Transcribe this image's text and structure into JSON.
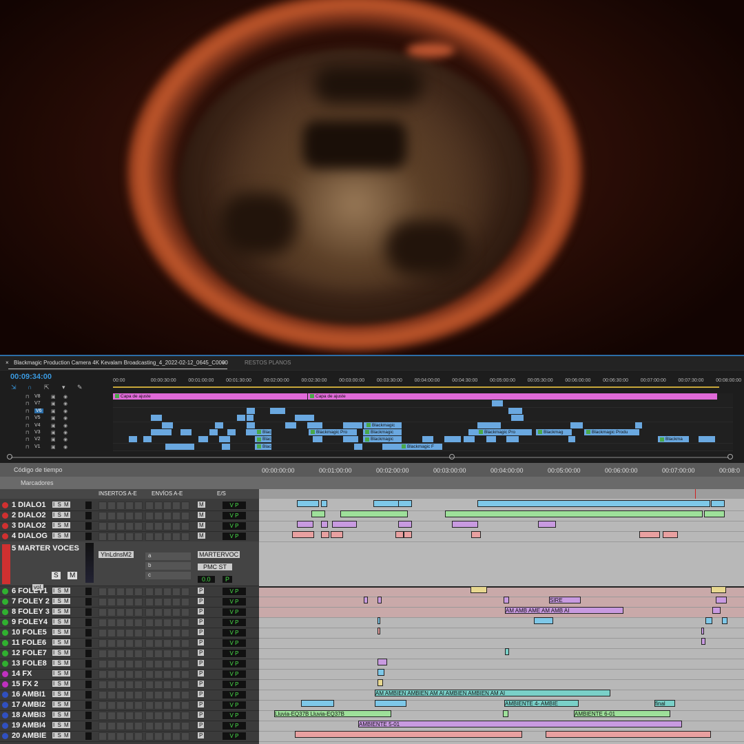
{
  "premiere": {
    "sequence_tab": "Blackmagic Production Camera 4K Kevalam Broadcasting_4_2022-02-12_0645_C0000",
    "second_tab": "RESTOS PLANOS",
    "timecode": "00:09:34:00",
    "ruler": [
      "00:00",
      "00:00:30:00",
      "00:01:00:00",
      "00:01:30:00",
      "00:02:00:00",
      "00:02:30:00",
      "00:03:00:00",
      "00:03:30:00",
      "00:04:00:00",
      "00:04:30:00",
      "00:05:00:00",
      "00:05:30:00",
      "00:06:00:00",
      "00:06:30:00",
      "00:07:00:00",
      "00:07:30:00",
      "00:08:00:00"
    ],
    "tracks": [
      "V8",
      "V7",
      "V6",
      "V5",
      "V4",
      "V3",
      "V2",
      "V1"
    ],
    "selected_track": "V6",
    "adjustment_clip": "Capa de ajuste",
    "clip_blackmagic": "Blackmagic",
    "clip_blackmagic_pro": "Blackmagic Pro",
    "clip_blackmagic_produ": "Blackmagic Produ",
    "clip_black": "Black",
    "clip_blackmag": "Blackmag",
    "clip_blackma": "Blackma",
    "clip_blackmagic_f": "Blackmagic F"
  },
  "protools": {
    "timecode_label": "Código de tiempo",
    "markers_label": "Marcadores",
    "ruler": [
      "00:00:00:00",
      "00:01:00:00",
      "00:02:00:00",
      "00:03:00:00",
      "00:04:00:00",
      "00:05:00:00",
      "00:06:00:00",
      "00:07:00:00",
      "00:08:0"
    ],
    "col_inserts": "INSERTOS A-E",
    "col_sends": "ENVÍOS A-E",
    "col_io": "E/S",
    "ism": "I S M",
    "io_m": "M",
    "io_p": "P",
    "vp": "V P",
    "master": {
      "name": "5 MARTER VOCES",
      "insert": "YlnLdnsM2",
      "out": "MARTERVOC",
      "pan": "PMC ST",
      "vol_label": "vol.",
      "value": "0.0",
      "s": "S",
      "m": "M",
      "send_a": "a",
      "send_b": "b",
      "send_c": "c",
      "p": "P"
    },
    "tracks": [
      {
        "name": "1 DIALO1",
        "color": "#d03030"
      },
      {
        "name": "2 DIALO2",
        "color": "#d03030"
      },
      {
        "name": "3 DIALO2",
        "color": "#d03030"
      },
      {
        "name": "4 DIALOG",
        "color": "#d03030"
      },
      {
        "name": "6 FOLEY1",
        "color": "#30b030"
      },
      {
        "name": "7 FOLEY 2",
        "color": "#30b030"
      },
      {
        "name": "8 FOLEY 3",
        "color": "#30b030"
      },
      {
        "name": "9 FOLEY4",
        "color": "#30b030"
      },
      {
        "name": "10 FOLE5",
        "color": "#30b030"
      },
      {
        "name": "11 FOLE6",
        "color": "#30b030"
      },
      {
        "name": "12 FOLE7",
        "color": "#30b030"
      },
      {
        "name": "13 FOLE8",
        "color": "#30b030"
      },
      {
        "name": "14 FX",
        "color": "#c030c0"
      },
      {
        "name": "15 FX 2",
        "color": "#c030c0"
      },
      {
        "name": "16 AMBI1",
        "color": "#3050c0"
      },
      {
        "name": "17 AMBI2",
        "color": "#3050c0"
      },
      {
        "name": "18 AMBI3",
        "color": "#3050c0"
      },
      {
        "name": "19 AMBI4",
        "color": "#3050c0"
      },
      {
        "name": "20 AMBIE",
        "color": "#3050c0"
      }
    ],
    "clips": {
      "sire": "SIRE",
      "am_amb": "AM AMB AME AM AMB AI",
      "ambien": "AM AMBIEN AMBIEN AM AI AMBIEN AMBIEN AM AI",
      "ambiente4": "AMBIENTE 4- AMBIE",
      "final": "final",
      "lluvia": "Lluvia-EQ37B Lluvia-EQ37B",
      "ambiente601": "AMBIENTE 6-01",
      "ambiente501": "AMBIENTE 5-01"
    }
  }
}
